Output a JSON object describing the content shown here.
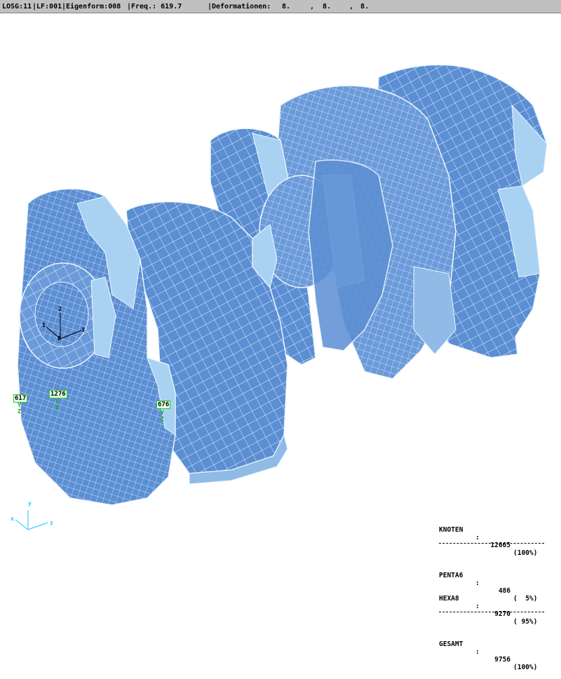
{
  "header": {
    "losg": "LOSG:11",
    "lf": "LF:001",
    "eigenform": "Eigenform:008",
    "freq": "Freq.: 619.7",
    "deformationen": "Deformationen:",
    "def_values": [
      "8.",
      ",",
      "8.",
      ",",
      "8."
    ]
  },
  "model": {
    "name": "crankshaft-fe-mesh",
    "mesh_fill": "#5b8ed3",
    "mesh_light": "#a9d2f2",
    "mesh_edge": "#eef6ff"
  },
  "local_axes": {
    "labels": [
      "1",
      "2",
      "3",
      "0"
    ]
  },
  "node_labels": [
    {
      "id": "617",
      "marks": [
        "Y",
        "Z"
      ]
    },
    {
      "id": "1276",
      "marks": [
        "Y",
        "X"
      ]
    },
    {
      "id": "676",
      "marks": [
        "Y",
        "Z"
      ]
    }
  ],
  "global_axes": {
    "x": "x",
    "y": "y",
    "z": "z",
    "color": "#19c8ff"
  },
  "stats": {
    "knoten_label": "KNOTEN",
    "knoten_value": "12665",
    "knoten_pct": "(100%)",
    "penta_label": "PENTA6",
    "penta_value": "486",
    "penta_pct": "(  5%)",
    "hexa_label": "HEXA8",
    "hexa_value": "9270",
    "hexa_pct": "( 95%)",
    "gesamt_label": "GESAMT",
    "gesamt_value": "9756",
    "gesamt_pct": "(100%)"
  }
}
